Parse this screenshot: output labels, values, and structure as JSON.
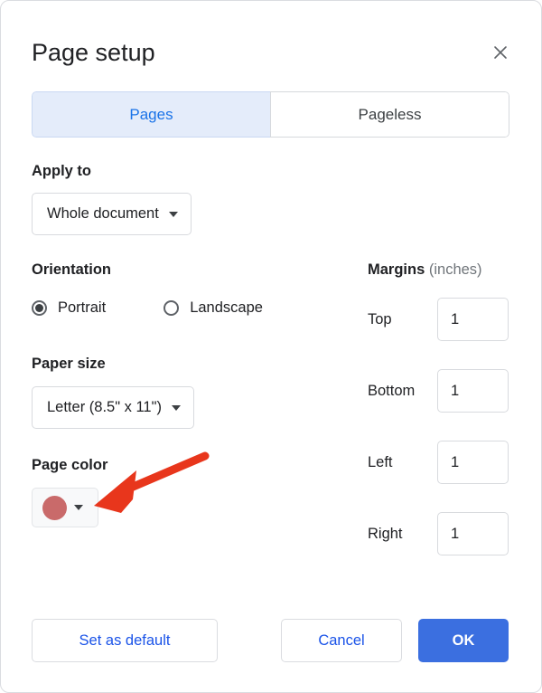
{
  "dialog": {
    "title": "Page setup",
    "close_icon": "close-icon"
  },
  "tabs": [
    {
      "label": "Pages",
      "active": true
    },
    {
      "label": "Pageless",
      "active": false
    }
  ],
  "apply_to": {
    "label": "Apply to",
    "value": "Whole document"
  },
  "orientation": {
    "label": "Orientation",
    "options": [
      {
        "label": "Portrait",
        "selected": true
      },
      {
        "label": "Landscape",
        "selected": false
      }
    ]
  },
  "paper_size": {
    "label": "Paper size",
    "value": "Letter (8.5\" x 11\")"
  },
  "page_color": {
    "label": "Page color",
    "swatch_color": "#c96a6a"
  },
  "margins": {
    "title": "Margins",
    "unit": "(inches)",
    "fields": [
      {
        "label": "Top",
        "value": "1"
      },
      {
        "label": "Bottom",
        "value": "1"
      },
      {
        "label": "Left",
        "value": "1"
      },
      {
        "label": "Right",
        "value": "1"
      }
    ]
  },
  "footer": {
    "set_as_default": "Set as default",
    "cancel": "Cancel",
    "ok": "OK"
  },
  "annotation": {
    "arrow_color": "#e8361c"
  },
  "colors": {
    "accent_blue": "#1a73e8",
    "primary_button": "#3b6fe0",
    "tab_active_bg": "#e4ecfa"
  }
}
